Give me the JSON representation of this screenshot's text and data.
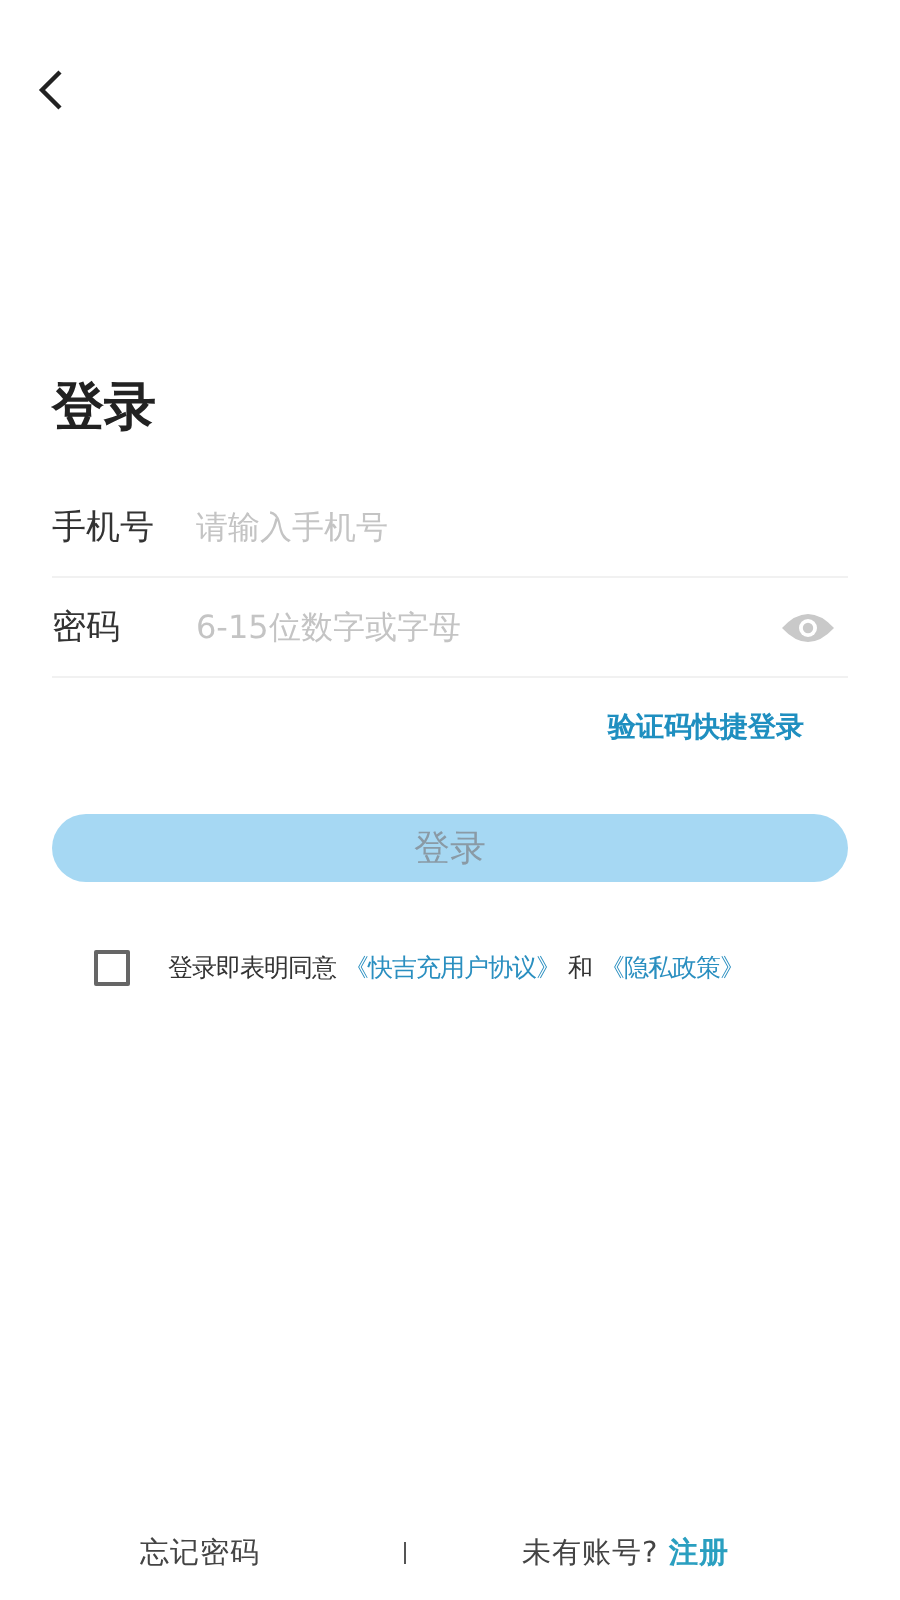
{
  "title": "登录",
  "fields": [
    {
      "label": "手机号",
      "placeholder": "请输入手机号",
      "kind": "text"
    },
    {
      "label": "密码",
      "placeholder": "6-15位数字或字母",
      "kind": "password"
    }
  ],
  "quick_login_link": "验证码快捷登录",
  "login_button": {
    "label": "登录",
    "disabled": true
  },
  "agreement": {
    "checked": false,
    "parts": [
      {
        "text": "登录即表明同意",
        "kind": "text"
      },
      {
        "text": "《快吉充用户协议》",
        "kind": "link"
      },
      {
        "text": "和",
        "kind": "text"
      },
      {
        "text": "《隐私政策》",
        "kind": "link"
      }
    ]
  },
  "footer": {
    "forgot": "忘记密码",
    "no_account": "未有账号?",
    "register": "注册"
  }
}
